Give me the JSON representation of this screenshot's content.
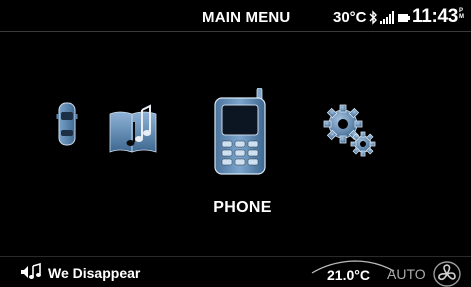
{
  "header": {
    "title": "MAIN MENU",
    "outside_temp": "30°C",
    "time": "11:43",
    "ampm_top": "P",
    "ampm_bottom": "M"
  },
  "icons": {
    "status": [
      "bluetooth-icon",
      "signal-strength-icon",
      "battery-icon"
    ],
    "menu": [
      "car-icon",
      "music-icon",
      "phone-icon",
      "settings-icon"
    ]
  },
  "main": {
    "selected_label": "PHONE"
  },
  "footer": {
    "now_playing": "We Disappear",
    "cabin_temp": "21.0°C",
    "climate_mode": "AUTO"
  },
  "colors": {
    "background": "#000000",
    "icon_blue": "#5d87b0",
    "text": "#ffffff"
  }
}
